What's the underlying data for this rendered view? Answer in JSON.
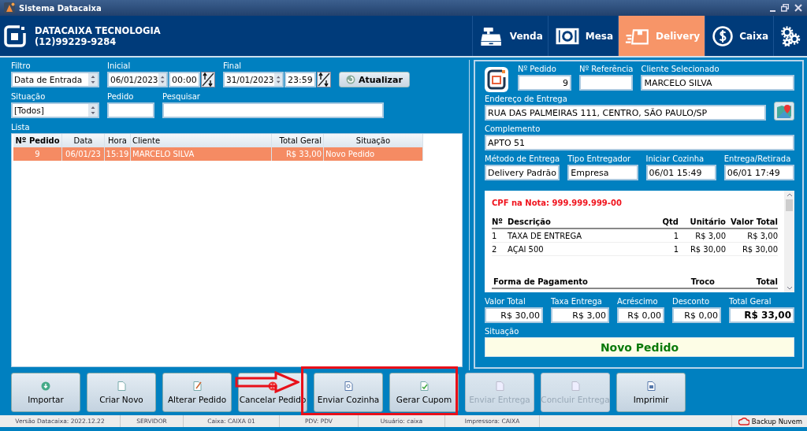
{
  "window": {
    "title": "Sistema Datacaixa"
  },
  "header": {
    "company": "DATACAIXA TECNOLOGIA",
    "phone": "(12)99229-9284",
    "nav": [
      {
        "label": "Venda",
        "selected": false
      },
      {
        "label": "Mesa",
        "selected": false
      },
      {
        "label": "Delivery",
        "selected": true
      },
      {
        "label": "Caixa",
        "selected": false
      }
    ]
  },
  "filters": {
    "filtro": {
      "label": "Filtro",
      "value": "Data de Entrada"
    },
    "inicial": {
      "label": "Inicial",
      "date": "06/01/2023",
      "time": "00:00"
    },
    "final": {
      "label": "Final",
      "date": "31/01/2023",
      "time": "23:59"
    },
    "refresh_button": "Atualizar",
    "situacao": {
      "label": "Situação",
      "value": "[Todos]"
    },
    "pedido": {
      "label": "Pedido"
    },
    "pesquisar": {
      "label": "Pesquisar"
    }
  },
  "list": {
    "label": "Lista",
    "columns": [
      "Nº Pedido",
      "Data",
      "Hora",
      "Cliente",
      "Total Geral",
      "Situação"
    ],
    "rows": [
      {
        "cells": [
          "9",
          "06/01/23",
          "15:19",
          "MARCELO SILVA",
          "R$ 33,00",
          "Novo Pedido"
        ],
        "selected": true
      }
    ]
  },
  "order": {
    "numero": {
      "label": "Nº Pedido",
      "value": "9"
    },
    "referencia": {
      "label": "Nº Referência"
    },
    "cliente": {
      "label": "Cliente Selecionado",
      "value": "MARCELO SILVA"
    },
    "endereco": {
      "label": "Endereço de Entrega",
      "value": "RUA DAS PALMEIRAS 111, CENTRO, SÃO PAULO/SP"
    },
    "complemento": {
      "label": "Complemento",
      "value": "APTO 51"
    },
    "details": [
      {
        "label": "Método de Entrega",
        "value": "Delivery Padrão"
      },
      {
        "label": "Tipo Entregador",
        "value": "Empresa"
      },
      {
        "label": "Iniciar Cozinha",
        "value": "06/01 15:49"
      },
      {
        "label": "Entrega/Retirada",
        "value": "06/01 17:49"
      }
    ],
    "receipt": {
      "cpf": "CPF na Nota: 999.999.999-00",
      "columns": [
        "Nº",
        "Descrição",
        "Qtd",
        "Unitário",
        "Valor Total"
      ],
      "items": [
        [
          "1",
          "TAXA DE ENTREGA",
          "1",
          "R$ 3,00",
          "R$ 3,00"
        ],
        [
          "2",
          "AÇAI 500",
          "1",
          "R$ 30,00",
          "R$ 30,00"
        ]
      ],
      "payment_columns": [
        "Forma de Pagamento",
        "Troco",
        "Total"
      ]
    },
    "totals": [
      {
        "label": "Valor Total",
        "value": "R$ 30,00"
      },
      {
        "label": "Taxa Entrega",
        "value": "R$ 3,00"
      },
      {
        "label": "Acréscimo",
        "value": "R$ 0,00"
      },
      {
        "label": "Desconto",
        "value": "R$ 0,00"
      },
      {
        "label": "Total Geral",
        "value": "R$ 33,00"
      }
    ],
    "status": {
      "label": "Situação",
      "value": "Novo Pedido"
    }
  },
  "buttons": [
    {
      "label": "Importar",
      "disabled": false
    },
    {
      "label": "Criar Novo",
      "disabled": false
    },
    {
      "label": "Alterar Pedido",
      "disabled": false
    },
    {
      "label": "Cancelar Pedido",
      "disabled": false
    },
    {
      "label": "Enviar Cozinha",
      "disabled": false
    },
    {
      "label": "Gerar Cupom",
      "disabled": false
    },
    {
      "label": "Enviar Entrega",
      "disabled": true
    },
    {
      "label": "Concluir Entrega",
      "disabled": true
    },
    {
      "label": "Imprimir",
      "disabled": false
    }
  ],
  "status_bar": [
    "Versão Datacaixa: 2022.12.22",
    "SERVIDOR",
    "Caixa: CAIXA 01",
    "PDV: PDV",
    "Usuário: caixa",
    "Impressora: CAIXA"
  ],
  "backup": "Backup Nuvem"
}
